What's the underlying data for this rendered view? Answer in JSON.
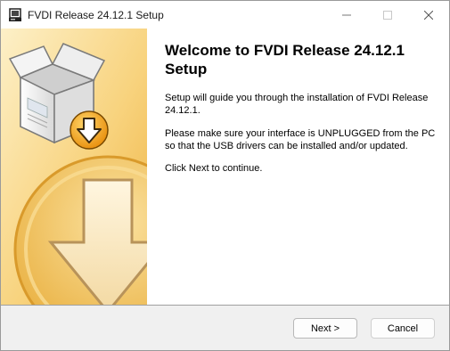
{
  "window": {
    "title": "FVDI Release 24.12.1 Setup"
  },
  "titlebar": {
    "minimize_icon": "minimize-icon",
    "maximize_icon": "maximize-icon",
    "close_icon": "close-icon"
  },
  "welcome": {
    "heading": "Welcome to FVDI Release 24.12.1 Setup",
    "paragraph1": "Setup will guide you through the installation of FVDI Release 24.12.1.",
    "paragraph2": "Please make sure your interface is UNPLUGGED from the PC so that the USB drivers can be installed and/or updated.",
    "paragraph3": "Click Next to continue."
  },
  "buttons": {
    "next_label": "Next >",
    "cancel_label": "Cancel"
  },
  "colors": {
    "banner_light": "#fbe3a5",
    "banner_mid": "#f5c661",
    "banner_dark": "#e8a52c"
  }
}
